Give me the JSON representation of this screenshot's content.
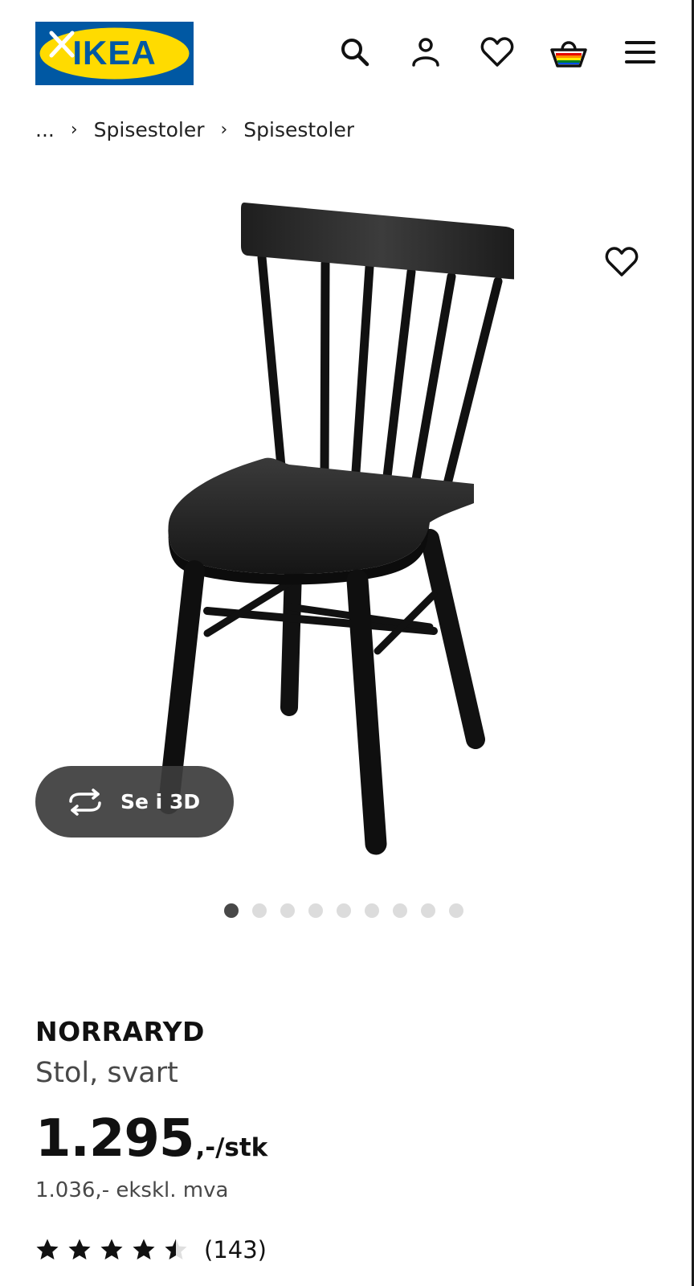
{
  "header": {
    "logo_text": "IKEA",
    "icons": [
      "search-icon",
      "account-icon",
      "heart-icon",
      "cart-icon",
      "menu-icon"
    ]
  },
  "breadcrumb": {
    "ellipsis": "...",
    "items": [
      "Spisestoler",
      "Spisestoler"
    ]
  },
  "gallery": {
    "view_3d_label": "Se i 3D",
    "dot_count": 9,
    "active_dot": 1
  },
  "product": {
    "name": "NORRARYD",
    "description": "Stol, svart",
    "price_integer": "1.295",
    "price_suffix": ",-/stk",
    "price_ex_vat": "1.036,- ekskl. mva",
    "rating_value": 4.5,
    "rating_count": "(143)"
  },
  "colors": {
    "ikea_blue": "#0058a3",
    "ikea_yellow": "#ffdb00",
    "text_primary": "#111111",
    "text_secondary": "#484848"
  }
}
